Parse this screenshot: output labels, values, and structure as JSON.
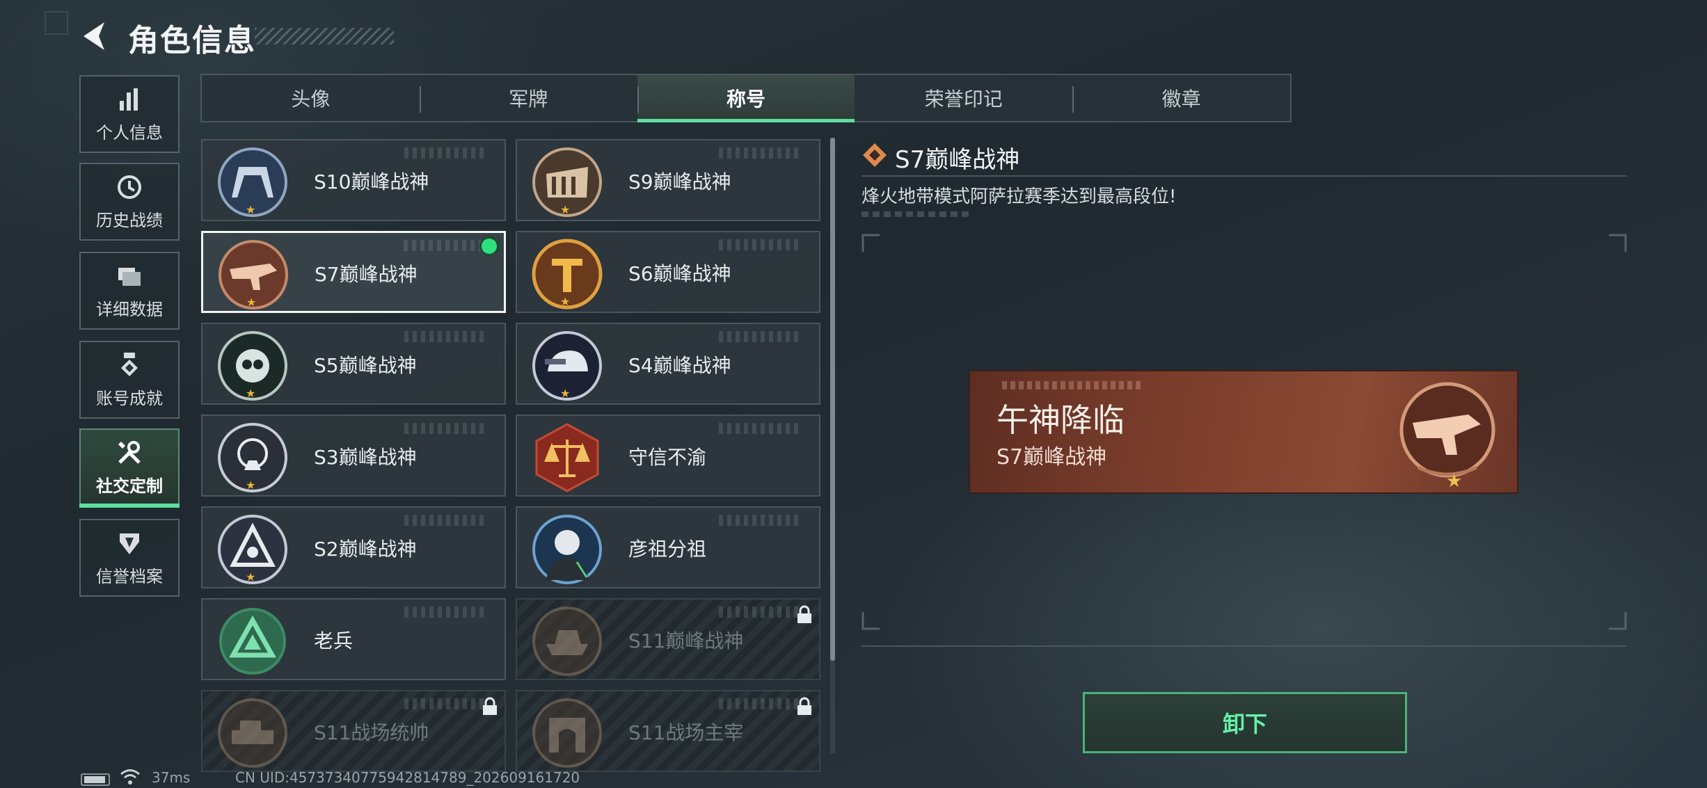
{
  "header": {
    "title": "角色信息"
  },
  "nav": {
    "items": [
      {
        "label": "个人信息",
        "icon": "bar-chart-icon"
      },
      {
        "label": "历史战绩",
        "icon": "clock-icon"
      },
      {
        "label": "详细数据",
        "icon": "folder-icon"
      },
      {
        "label": "账号成就",
        "icon": "medal-icon"
      },
      {
        "label": "社交定制",
        "icon": "tools-icon",
        "active": true
      },
      {
        "label": "信誉档案",
        "icon": "shield-icon"
      }
    ]
  },
  "tabs": [
    {
      "label": "头像"
    },
    {
      "label": "军牌"
    },
    {
      "label": "称号",
      "active": true
    },
    {
      "label": "荣誉印记"
    },
    {
      "label": "徽章"
    }
  ],
  "titles": [
    {
      "name": "S10巅峰战神",
      "locked": false
    },
    {
      "name": "S9巅峰战神",
      "locked": false
    },
    {
      "name": "S7巅峰战神",
      "locked": false,
      "selected": true,
      "equipped": true
    },
    {
      "name": "S6巅峰战神",
      "locked": false
    },
    {
      "name": "S5巅峰战神",
      "locked": false
    },
    {
      "name": "S4巅峰战神",
      "locked": false
    },
    {
      "name": "S3巅峰战神",
      "locked": false
    },
    {
      "name": "守信不渝",
      "locked": false
    },
    {
      "name": "S2巅峰战神",
      "locked": false
    },
    {
      "name": "彦祖分祖",
      "locked": false
    },
    {
      "name": "老兵",
      "locked": false
    },
    {
      "name": "S11巅峰战神",
      "locked": true
    },
    {
      "name": "S11战场统帅",
      "locked": true
    },
    {
      "name": "S11战场主宰",
      "locked": true
    }
  ],
  "detail": {
    "title": "S7巅峰战神",
    "description": "烽火地带模式阿萨拉赛季达到最高段位!",
    "banner_main": "午神降临",
    "banner_sub": "S7巅峰战神",
    "unequip_label": "卸下"
  },
  "status": {
    "ping": "37ms",
    "uid": "CN UID:4573734077594281478​9_202609161720"
  },
  "colors": {
    "accent_green": "#5ee0a0",
    "equipped_dot": "#2ee07e",
    "banner_bg": "#7a3d2b",
    "star_gold": "#e9b53a"
  }
}
